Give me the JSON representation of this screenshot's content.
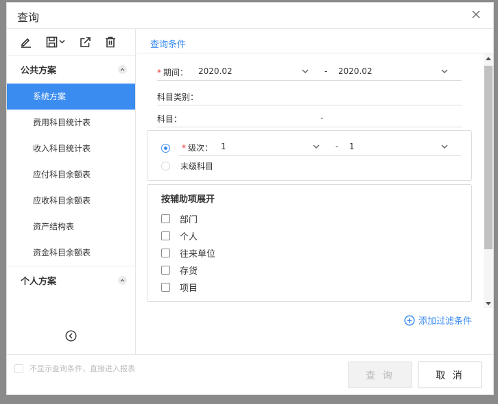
{
  "dialog": {
    "title": "查询"
  },
  "sidebar": {
    "groups": [
      {
        "name": "公共方案",
        "items": [
          "系统方案",
          "费用科目统计表",
          "收入科目统计表",
          "应付科目余额表",
          "应收科目余额表",
          "资产结构表",
          "资金科目余额表"
        ],
        "active_index": 0
      },
      {
        "name": "个人方案",
        "items": []
      }
    ]
  },
  "main": {
    "tab": "查询条件",
    "period": {
      "label": "期间：",
      "from": "2020.02",
      "separator": "-",
      "to": "2020.02"
    },
    "subject_category": {
      "label": "科目类别："
    },
    "subject": {
      "label": "科目：",
      "separator": "-"
    },
    "level": {
      "label": "级次：",
      "from": "1",
      "separator": "-",
      "to": "1",
      "selected": true
    },
    "leaf_subject": {
      "label": "末级科目",
      "selected": false
    },
    "aux_expand": {
      "title": "按辅助项展开",
      "options": [
        "部门",
        "个人",
        "往来单位",
        "存货",
        "项目"
      ]
    },
    "add_filter": "添加过滤条件"
  },
  "footer": {
    "skip_label": "不显示查询条件，直接进入报表",
    "query_button": "查 询",
    "cancel_button": "取 消"
  },
  "colors": {
    "accent": "#3b8cf0",
    "required": "#e5322d"
  }
}
